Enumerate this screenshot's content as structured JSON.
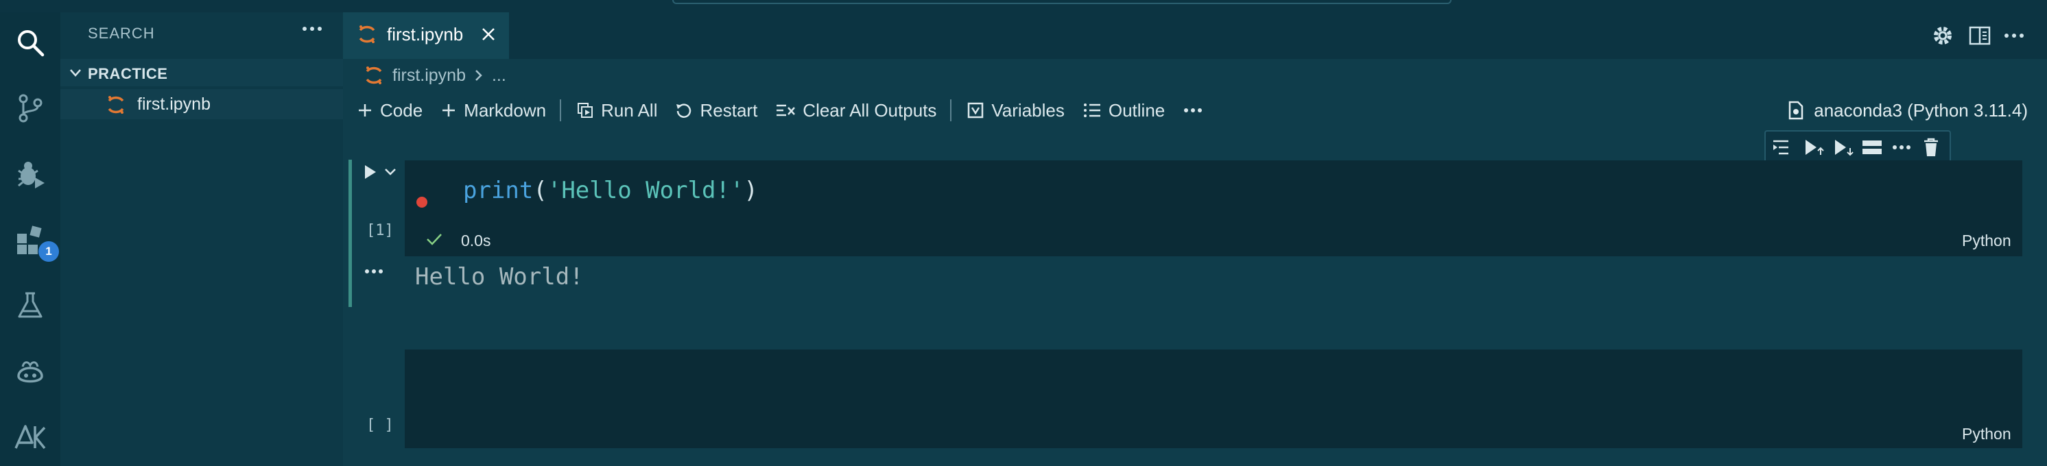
{
  "sidebar": {
    "title": "SEARCH",
    "section_label": "PRACTICE",
    "file_label": "first.ipynb"
  },
  "activity": {
    "extensions_badge": "1"
  },
  "tab": {
    "label": "first.ipynb"
  },
  "breadcrumb": {
    "file": "first.ipynb",
    "rest": "..."
  },
  "toolbar": {
    "code_label": "Code",
    "markdown_label": "Markdown",
    "run_all_label": "Run All",
    "restart_label": "Restart",
    "clear_label": "Clear All Outputs",
    "variables_label": "Variables",
    "outline_label": "Outline"
  },
  "kernel": {
    "label": "anaconda3 (Python 3.11.4)"
  },
  "cells": [
    {
      "code_fn": "print",
      "code_open": "(",
      "code_str": "'Hello World!'",
      "code_close": ")",
      "exec_count": "[1]",
      "duration": "0.0s",
      "language": "Python",
      "output": "Hello World!"
    },
    {
      "exec_count": "[ ]",
      "language": "Python"
    }
  ],
  "colors": {
    "accent": "#e37933",
    "run_bar": "#3c8f86",
    "breakpoint": "#e0463a",
    "success": "#89d185",
    "badge": "#2f7fd6"
  }
}
